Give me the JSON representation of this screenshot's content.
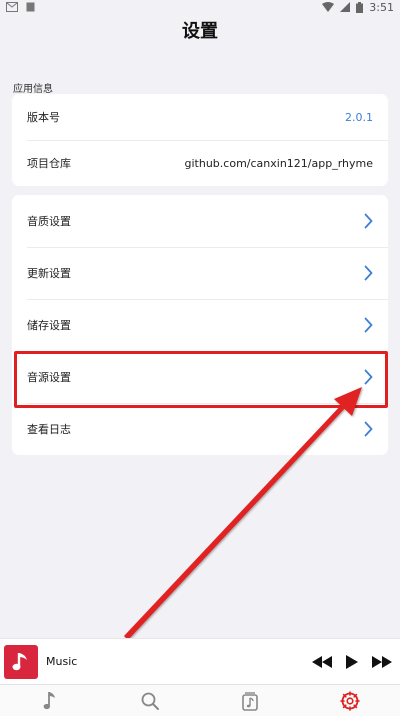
{
  "status_bar": {
    "time": "3:51"
  },
  "page_title": "设置",
  "app_info": {
    "section_label": "应用信息",
    "rows": [
      {
        "label": "版本号",
        "value": "2.0.1"
      },
      {
        "label": "项目仓库",
        "value": "github.com/canxin121/app_rhyme"
      }
    ]
  },
  "settings_items": [
    {
      "label": "音质设置"
    },
    {
      "label": "更新设置"
    },
    {
      "label": "储存设置"
    },
    {
      "label": "音源设置"
    },
    {
      "label": "查看日志"
    }
  ],
  "player": {
    "track_title": "Music"
  },
  "colors": {
    "accent": "#3c7fd6",
    "highlight": "#e02020",
    "album": "#d7263d"
  },
  "icons": {
    "status": [
      "mail-icon",
      "sim-icon",
      "wifi-icon",
      "signal-icon",
      "battery-icon"
    ],
    "tabs": [
      "music-note-icon",
      "search-icon",
      "library-icon",
      "settings-icon"
    ]
  }
}
